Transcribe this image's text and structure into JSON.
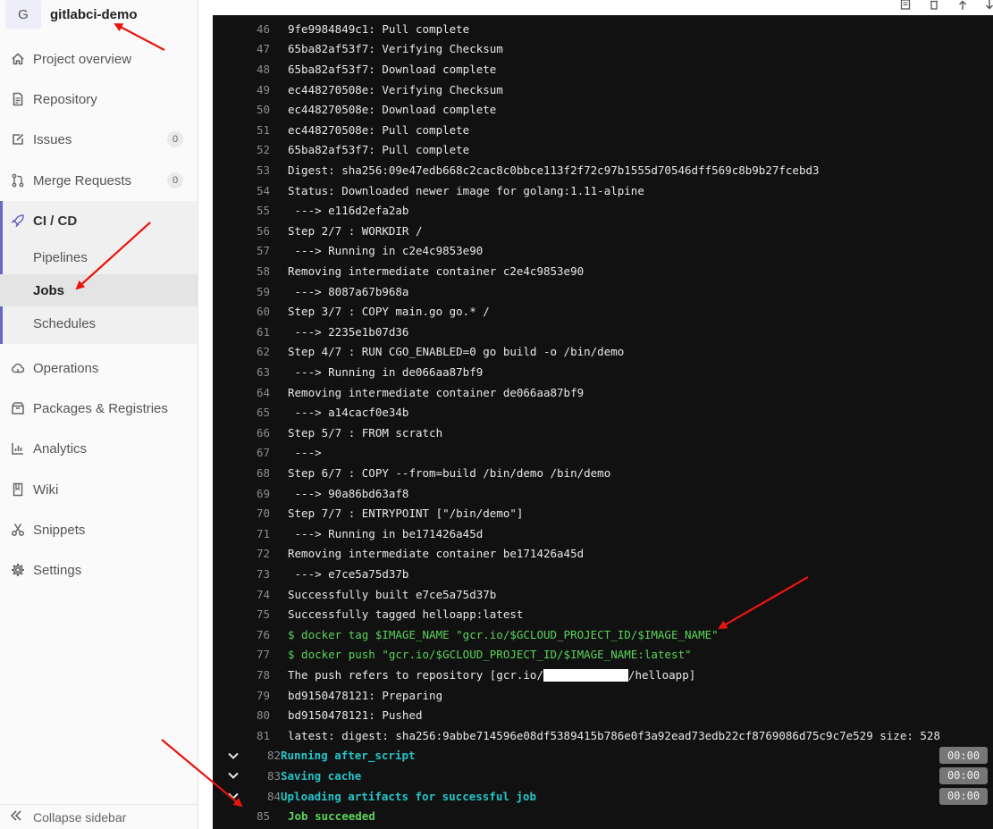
{
  "project": {
    "avatar_letter": "G",
    "name": "gitlabci-demo"
  },
  "sidebar": {
    "items": [
      {
        "label": "Project overview",
        "icon": "home-icon"
      },
      {
        "label": "Repository",
        "icon": "document-icon"
      },
      {
        "label": "Issues",
        "icon": "issues-icon",
        "count": "0"
      },
      {
        "label": "Merge Requests",
        "icon": "merge-request-icon",
        "count": "0"
      },
      {
        "label": "CI / CD",
        "icon": "rocket-icon"
      },
      {
        "label": "Operations",
        "icon": "cloud-icon"
      },
      {
        "label": "Packages & Registries",
        "icon": "package-icon"
      },
      {
        "label": "Analytics",
        "icon": "chart-icon"
      },
      {
        "label": "Wiki",
        "icon": "book-icon"
      },
      {
        "label": "Snippets",
        "icon": "scissors-icon"
      },
      {
        "label": "Settings",
        "icon": "gear-icon"
      }
    ],
    "cicd_sub": [
      {
        "label": "Pipelines"
      },
      {
        "label": "Jobs",
        "active": true
      },
      {
        "label": "Schedules"
      }
    ],
    "collapse_label": "Collapse sidebar"
  },
  "log": {
    "lines": [
      {
        "n": "46",
        "t": "9fe9984849c1: Pull complete"
      },
      {
        "n": "47",
        "t": "65ba82af53f7: Verifying Checksum"
      },
      {
        "n": "48",
        "t": "65ba82af53f7: Download complete"
      },
      {
        "n": "49",
        "t": "ec448270508e: Verifying Checksum"
      },
      {
        "n": "50",
        "t": "ec448270508e: Download complete"
      },
      {
        "n": "51",
        "t": "ec448270508e: Pull complete"
      },
      {
        "n": "52",
        "t": "65ba82af53f7: Pull complete"
      },
      {
        "n": "53",
        "t": "Digest: sha256:09e47edb668c2cac8c0bbce113f2f72c97b1555d70546dff569c8b9b27fcebd3"
      },
      {
        "n": "54",
        "t": "Status: Downloaded newer image for golang:1.11-alpine"
      },
      {
        "n": "55",
        "t": " ---> e116d2efa2ab"
      },
      {
        "n": "56",
        "t": "Step 2/7 : WORKDIR /"
      },
      {
        "n": "57",
        "t": " ---> Running in c2e4c9853e90"
      },
      {
        "n": "58",
        "t": "Removing intermediate container c2e4c9853e90"
      },
      {
        "n": "59",
        "t": " ---> 8087a67b968a"
      },
      {
        "n": "60",
        "t": "Step 3/7 : COPY main.go go.* /"
      },
      {
        "n": "61",
        "t": " ---> 2235e1b07d36"
      },
      {
        "n": "62",
        "t": "Step 4/7 : RUN CGO_ENABLED=0 go build -o /bin/demo"
      },
      {
        "n": "63",
        "t": " ---> Running in de066aa87bf9"
      },
      {
        "n": "64",
        "t": "Removing intermediate container de066aa87bf9"
      },
      {
        "n": "65",
        "t": " ---> a14cacf0e34b"
      },
      {
        "n": "66",
        "t": "Step 5/7 : FROM scratch"
      },
      {
        "n": "67",
        "t": " --->"
      },
      {
        "n": "68",
        "t": "Step 6/7 : COPY --from=build /bin/demo /bin/demo"
      },
      {
        "n": "69",
        "t": " ---> 90a86bd63af8"
      },
      {
        "n": "70",
        "t": "Step 7/7 : ENTRYPOINT [\"/bin/demo\"]"
      },
      {
        "n": "71",
        "t": " ---> Running in be171426a45d"
      },
      {
        "n": "72",
        "t": "Removing intermediate container be171426a45d"
      },
      {
        "n": "73",
        "t": " ---> e7ce5a75d37b"
      },
      {
        "n": "74",
        "t": "Successfully built e7ce5a75d37b"
      },
      {
        "n": "75",
        "t": "Successfully tagged helloapp:latest"
      },
      {
        "n": "76",
        "t": "$ docker tag $IMAGE_NAME \"gcr.io/$GCLOUD_PROJECT_ID/$IMAGE_NAME\""
      },
      {
        "n": "77",
        "t": "$ docker push \"gcr.io/$GCLOUD_PROJECT_ID/$IMAGE_NAME:latest\""
      },
      {
        "n": "79",
        "t": "bd9150478121: Preparing"
      },
      {
        "n": "80",
        "t": "bd9150478121: Pushed"
      },
      {
        "n": "81",
        "t": "latest: digest: sha256:9abbe714596e08df5389415b786e0f3a92ead73edb22cf8769086d75c9c7e529 size: 528"
      }
    ],
    "line78": {
      "n": "78",
      "pre": "The push refers to repository [gcr.io/",
      "post": "/helloapp]"
    },
    "sections": [
      {
        "n": "82",
        "t": "Running after_script",
        "duration": "00:00"
      },
      {
        "n": "83",
        "t": "Saving cache",
        "duration": "00:00"
      },
      {
        "n": "84",
        "t": "Uploading artifacts for successful job",
        "duration": "00:00"
      }
    ],
    "final": {
      "n": "85",
      "t": "Job succeeded"
    }
  },
  "colors": {
    "terminal_bg": "#111111",
    "command_green": "#5bd35b",
    "section_cyan": "#25c3c8",
    "annotation_red": "#e8150f",
    "sidebar_accent": "#6666c4"
  }
}
